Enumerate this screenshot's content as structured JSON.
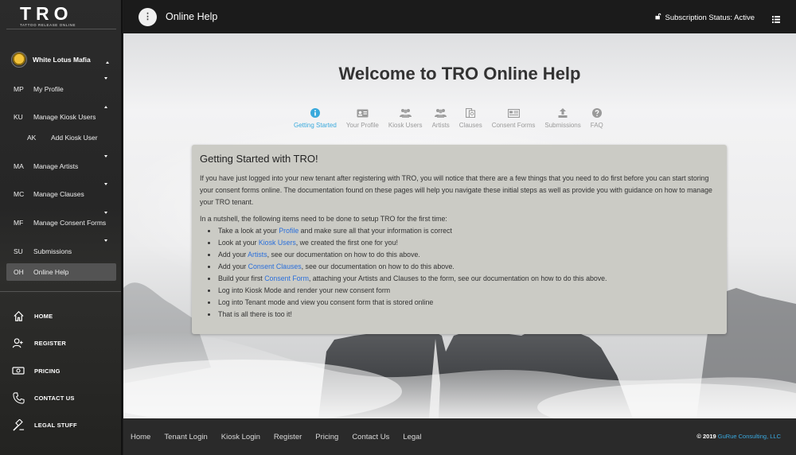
{
  "brand": {
    "logo": "TRO",
    "tagline": "TATTOO RELEASE ONLINE"
  },
  "sidebar": {
    "user": {
      "name": "White Lotus Mafia"
    },
    "nav": [
      {
        "abbr": "MP",
        "label": "My Profile"
      },
      {
        "abbr": "KU",
        "label": "Manage Kiosk Users"
      },
      {
        "abbr": "AK",
        "label": "Add Kiosk User"
      },
      {
        "abbr": "MA",
        "label": "Manage Artists"
      },
      {
        "abbr": "MC",
        "label": "Manage Clauses"
      },
      {
        "abbr": "MF",
        "label": "Manage Consent Forms"
      },
      {
        "abbr": "SU",
        "label": "Submissions"
      },
      {
        "abbr": "OH",
        "label": "Online Help"
      }
    ],
    "links": [
      {
        "label": "HOME",
        "icon": "home-icon"
      },
      {
        "label": "REGISTER",
        "icon": "add-user-icon"
      },
      {
        "label": "PRICING",
        "icon": "money-icon"
      },
      {
        "label": "CONTACT US",
        "icon": "phone-icon"
      },
      {
        "label": "LEGAL STUFF",
        "icon": "gavel-icon"
      }
    ]
  },
  "topbar": {
    "menu_glyph": "⋮",
    "title": "Online Help",
    "subscription": "Subscription Status: Active"
  },
  "main": {
    "welcome": "Welcome to TRO Online Help",
    "tabs": [
      {
        "label": "Getting Started",
        "icon": "info-icon",
        "active": true
      },
      {
        "label": "Your Profile",
        "icon": "id-card-icon"
      },
      {
        "label": "Kiosk Users",
        "icon": "users-icon"
      },
      {
        "label": "Artists",
        "icon": "users-icon"
      },
      {
        "label": "Clauses",
        "icon": "document-icon"
      },
      {
        "label": "Consent Forms",
        "icon": "form-icon"
      },
      {
        "label": "Submissions",
        "icon": "upload-icon"
      },
      {
        "label": "FAQ",
        "icon": "question-icon"
      }
    ],
    "card": {
      "title": "Getting Started with TRO!",
      "intro": "If you have just logged into your new tenant after registering with TRO, you will notice that there are a few things that you need to do first before you can start storing your consent forms online. The documentation found on these pages will help you navigate these initial steps as well as provide you with guidance on how to manage your TRO tenant.",
      "intro2": "In a nutshell, the following items need to be done to setup TRO for the first time:",
      "items": [
        {
          "pre": "Take a look at your ",
          "link": "Profile",
          "post": " and make sure all that your information is correct"
        },
        {
          "pre": "Look at your ",
          "link": "Kiosk Users",
          "post": ", we created the first one for you!"
        },
        {
          "pre": "Add your ",
          "link": "Artists",
          "post": ", see our documentation on how to do this above."
        },
        {
          "pre": "Add your ",
          "link": "Consent Clauses",
          "post": ", see our documentation on how to do this above."
        },
        {
          "pre": "Build your first ",
          "link": "Consent Form",
          "post": ", attaching your Artists and Clauses to the form, see our documentation on how to do this above."
        },
        {
          "pre": "Log into Kiosk Mode and render your new consent form",
          "link": "",
          "post": ""
        },
        {
          "pre": "Log into Tenant mode and view you consent form that is stored online",
          "link": "",
          "post": ""
        },
        {
          "pre": "That is all there is too it!",
          "link": "",
          "post": ""
        }
      ]
    }
  },
  "footer": {
    "links": [
      "Home",
      "Tenant Login",
      "Kiosk Login",
      "Register",
      "Pricing",
      "Contact Us",
      "Legal"
    ],
    "copyright_pre": "© 2019 ",
    "copyright_brand": "GuRue Consulting, LLC"
  },
  "colors": {
    "accent": "#39a9dc",
    "link": "#2a6fdb",
    "card": "#cbcbc5",
    "sidebar": "#262626"
  }
}
